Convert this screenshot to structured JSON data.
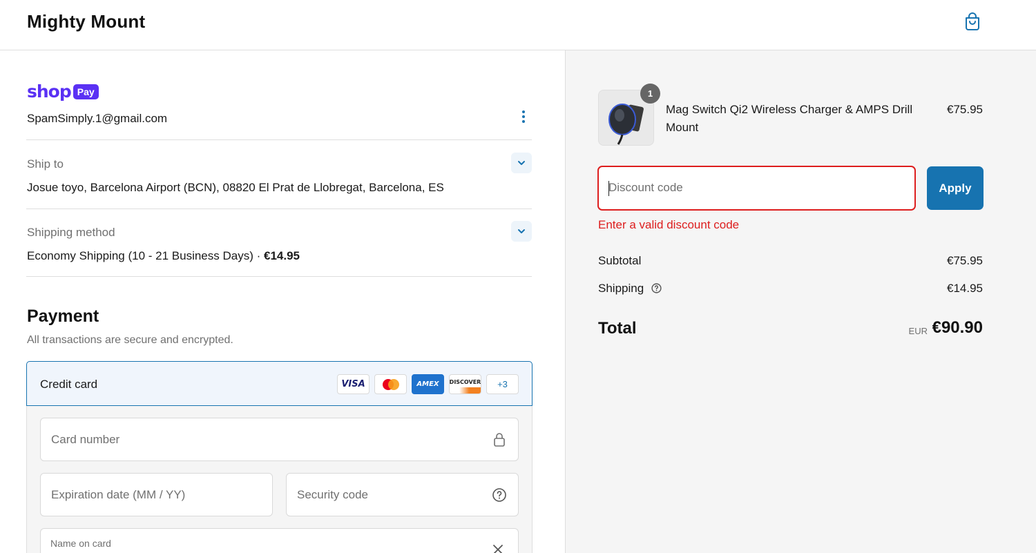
{
  "header": {
    "store_name": "Mighty Mount",
    "cart_icon": "shopping-bag-icon"
  },
  "shop_pay": {
    "logo_text": "shop",
    "badge_text": "Pay",
    "email": "SpamSimply.1@gmail.com",
    "menu_icon": "kebab-menu-icon"
  },
  "ship_to": {
    "label": "Ship to",
    "value": "Josue toyo, Barcelona Airport (BCN), 08820 El Prat de Llobregat, Barcelona, ES"
  },
  "shipping_method": {
    "label": "Shipping method",
    "value": "Economy Shipping (10 - 21 Business Days) · ",
    "price": "€14.95"
  },
  "payment": {
    "title": "Payment",
    "subtitle": "All transactions are secure and encrypted.",
    "method_label": "Credit card",
    "card_brands": [
      "VISA",
      "Mastercard",
      "AMEX",
      "DISCOVER"
    ],
    "more_brands": "+3",
    "card_number_placeholder": "Card number",
    "expiration_placeholder": "Expiration date (MM / YY)",
    "security_placeholder": "Security code",
    "name_label": "Name on card"
  },
  "summary": {
    "product": {
      "name": "Mag Switch Qi2 Wireless Charger & AMPS Drill Mount",
      "price": "€75.95",
      "quantity": "1"
    },
    "discount": {
      "placeholder": "Discount code",
      "value": "",
      "apply_label": "Apply",
      "error": "Enter a valid discount code"
    },
    "subtotal_label": "Subtotal",
    "subtotal_value": "€75.95",
    "shipping_label": "Shipping",
    "shipping_value": "€14.95",
    "total_label": "Total",
    "currency": "EUR",
    "total_value": "€90.90"
  },
  "colors": {
    "accent": "#1773b0",
    "error": "#dd1d1d",
    "shop_purple": "#5a31f4"
  }
}
